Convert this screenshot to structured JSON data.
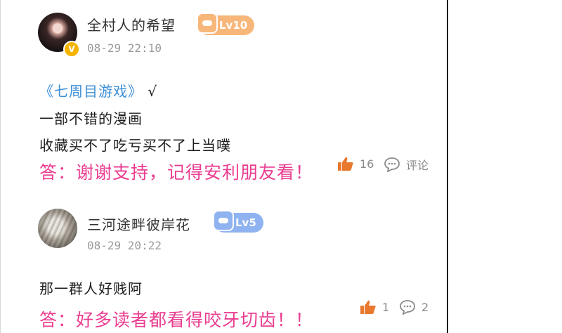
{
  "comments": [
    {
      "username": "全村人的希望",
      "level": "Lv10",
      "vip_badge": "V",
      "date": "08-29 22:10",
      "link_text": "《七周目游戏》",
      "link_suffix": "√",
      "lines": [
        "一部不错的漫画",
        "收藏买不了吃亏买不了上当噗"
      ],
      "reply": "答：谢谢支持，记得安利朋友看！",
      "likes": "16",
      "comment_label": "评论",
      "level_color": "#f8b77a"
    },
    {
      "username": "三河途畔彼岸花",
      "level": "Lv5",
      "date": "08-29 20:22",
      "lines": [
        "那一群人好贱阿"
      ],
      "reply": "答：好多读者都看得咬牙切齿！！",
      "likes": "1",
      "comment_count": "2",
      "level_color": "#8fb3f0"
    }
  ],
  "colors": {
    "reply_text": "#ea3c90",
    "link_text": "#3d8fd6",
    "like_icon": "#e8782e"
  },
  "icons": {
    "like": "thumb-up-icon",
    "comment": "chat-bubble-icon"
  }
}
